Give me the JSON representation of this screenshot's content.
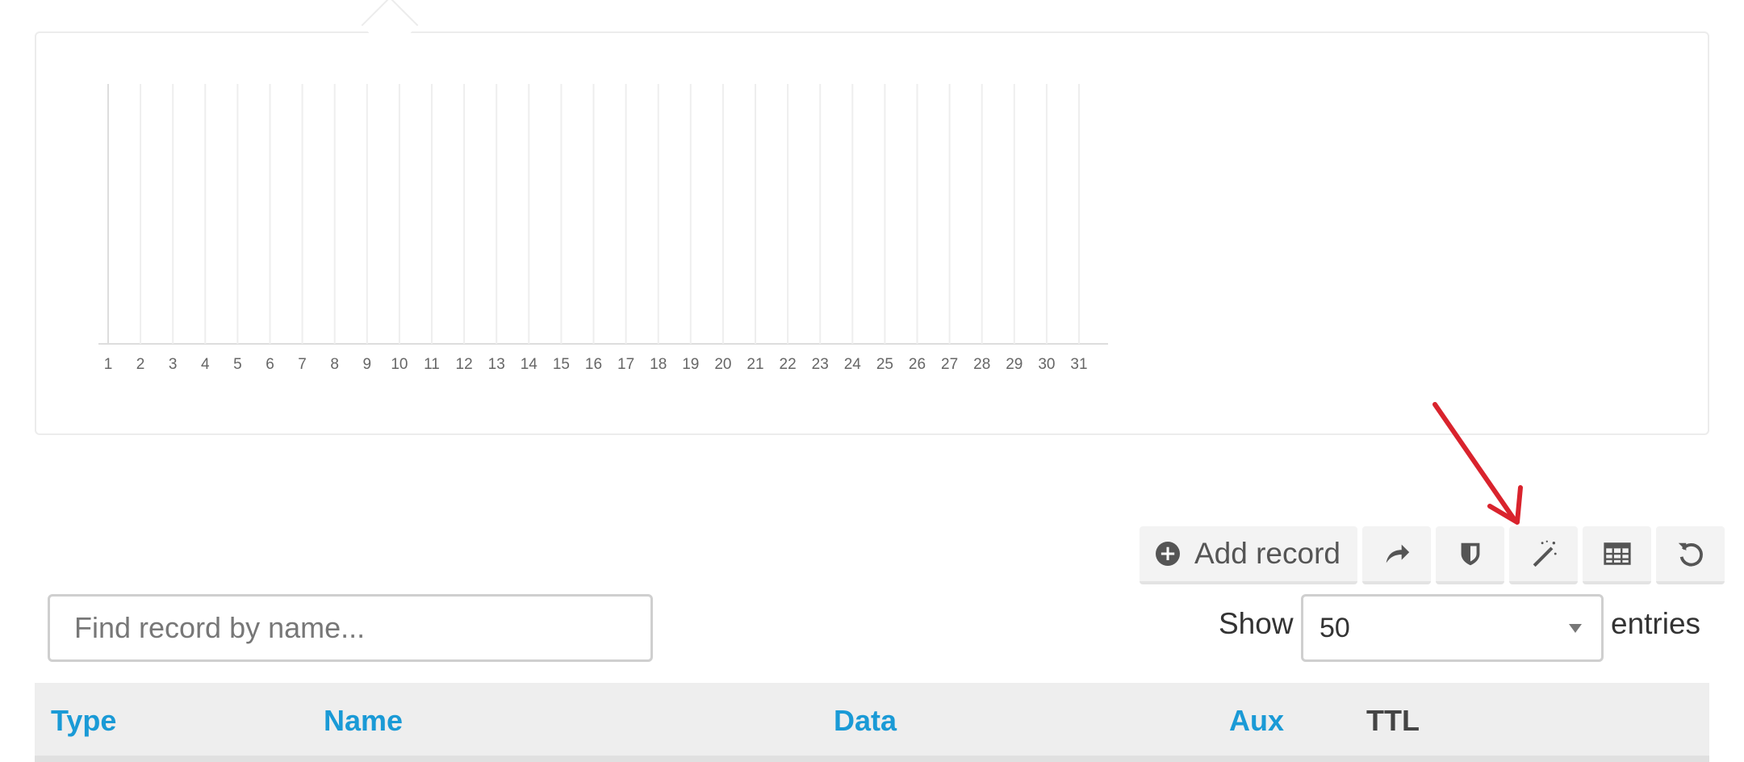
{
  "chart_data": {
    "type": "bar",
    "categories": [
      "1",
      "2",
      "3",
      "4",
      "5",
      "6",
      "7",
      "8",
      "9",
      "10",
      "11",
      "12",
      "13",
      "14",
      "15",
      "16",
      "17",
      "18",
      "19",
      "20",
      "21",
      "22",
      "23",
      "24",
      "25",
      "26",
      "27",
      "28",
      "29",
      "30",
      "31"
    ],
    "values": [
      0,
      0,
      0,
      0,
      0,
      0,
      0,
      0,
      0,
      0,
      0,
      0,
      0,
      0,
      0,
      0,
      0,
      0,
      0,
      0,
      0,
      0,
      0,
      0,
      0,
      0,
      0,
      0,
      0,
      0,
      0
    ],
    "title": "",
    "xlabel": "",
    "ylabel": "",
    "grid": true,
    "legend": "none"
  },
  "toolbar": {
    "add_record_label": "Add record",
    "buttons": [
      {
        "icon": "share-arrow-icon"
      },
      {
        "icon": "shield-icon"
      },
      {
        "icon": "magic-wand-icon"
      },
      {
        "icon": "table-icon"
      },
      {
        "icon": "refresh-icon"
      }
    ]
  },
  "search": {
    "placeholder": "Find record by name...",
    "value": ""
  },
  "entries": {
    "show_label": "Show",
    "selected": "50",
    "suffix_label": "entries"
  },
  "table": {
    "columns": [
      "Type",
      "Name",
      "Data",
      "Aux",
      "TTL"
    ]
  },
  "colors": {
    "link_blue": "#1a9ad6",
    "annotation_red": "#d9232d"
  }
}
